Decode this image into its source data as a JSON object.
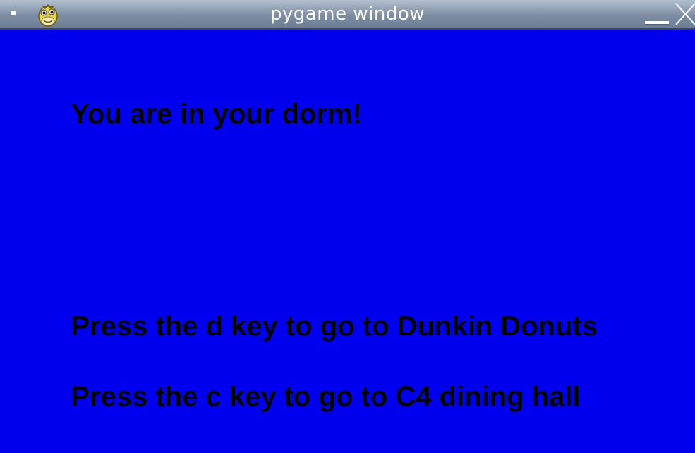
{
  "window": {
    "title": "pygame window",
    "menu_icon": "window-menu-icon",
    "app_icon": "pygame-snake-icon",
    "minimize_icon": "minimize-icon",
    "close_icon": "close-icon"
  },
  "game": {
    "background_color": "#0000ee",
    "text_color": "#000000",
    "location_message": "You are in your dorm!",
    "instructions": [
      "Press the d key to go to Dunkin Donuts",
      "Press the c key to go to C4 dining hall"
    ]
  }
}
